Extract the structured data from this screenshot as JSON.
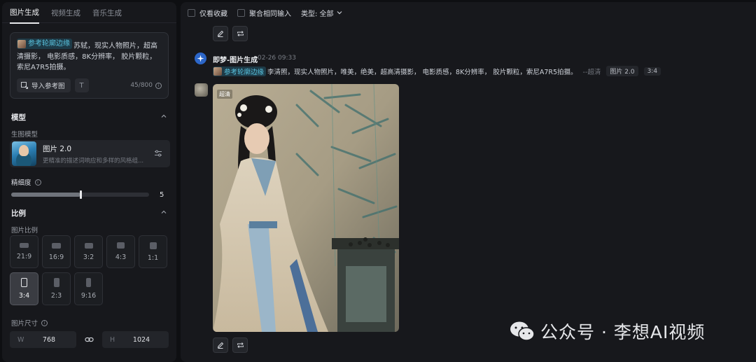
{
  "left_panel": {
    "tabs": [
      {
        "label": "图片生成",
        "active": true
      },
      {
        "label": "视频生成",
        "active": false
      },
      {
        "label": "音乐生成",
        "active": false
      }
    ],
    "prompt": {
      "ref_chip": "参考轮廓边缘",
      "text": "苏轼，现实人物照片，超高清摄影， 电影质感，8K分辨率， 胶片颗粒，索尼A7R5拍摄。",
      "import_label": "导入参考图",
      "counter": "45/800"
    },
    "model_section": {
      "title": "模型",
      "sub_label": "生图模型",
      "model_name": "图片 2.0",
      "model_desc": "更精准的描述词响应和多样的风格组..."
    },
    "precision": {
      "label": "精细度",
      "value": "5",
      "fill_fraction": 0.5
    },
    "ratio_section": {
      "title": "比例",
      "sub_label": "图片比例",
      "ratios": [
        {
          "label": "21:9",
          "active": false
        },
        {
          "label": "16:9",
          "active": false
        },
        {
          "label": "3:2",
          "active": false
        },
        {
          "label": "4:3",
          "active": false
        },
        {
          "label": "1:1",
          "active": false
        },
        {
          "label": "3:4",
          "active": true
        },
        {
          "label": "2:3",
          "active": false
        },
        {
          "label": "9:16",
          "active": false
        }
      ]
    },
    "size_section": {
      "label": "图片尺寸",
      "width_key": "W",
      "width_value": "768",
      "height_key": "H",
      "height_value": "1024"
    }
  },
  "right_panel": {
    "filters": {
      "favorites_only": "仅看收藏",
      "merge_same_input": "聚合相同输入",
      "type_filter": "类型: 全部"
    },
    "generation": {
      "title": "即梦-图片生成",
      "date": "02-26  09:33",
      "ref_chip": "参考轮廓边缘",
      "prompt": "李清照，现实人物照片，唯美，绝美，超高清摄影， 电影质感，8K分辨率， 胶片颗粒，索尼A7R5拍摄。",
      "quality": "--超清",
      "model_tag": "图片 2.0",
      "ratio_tag": "3:4",
      "image_badge": "超清"
    },
    "watermark": "公众号 · 李想AI视频"
  }
}
